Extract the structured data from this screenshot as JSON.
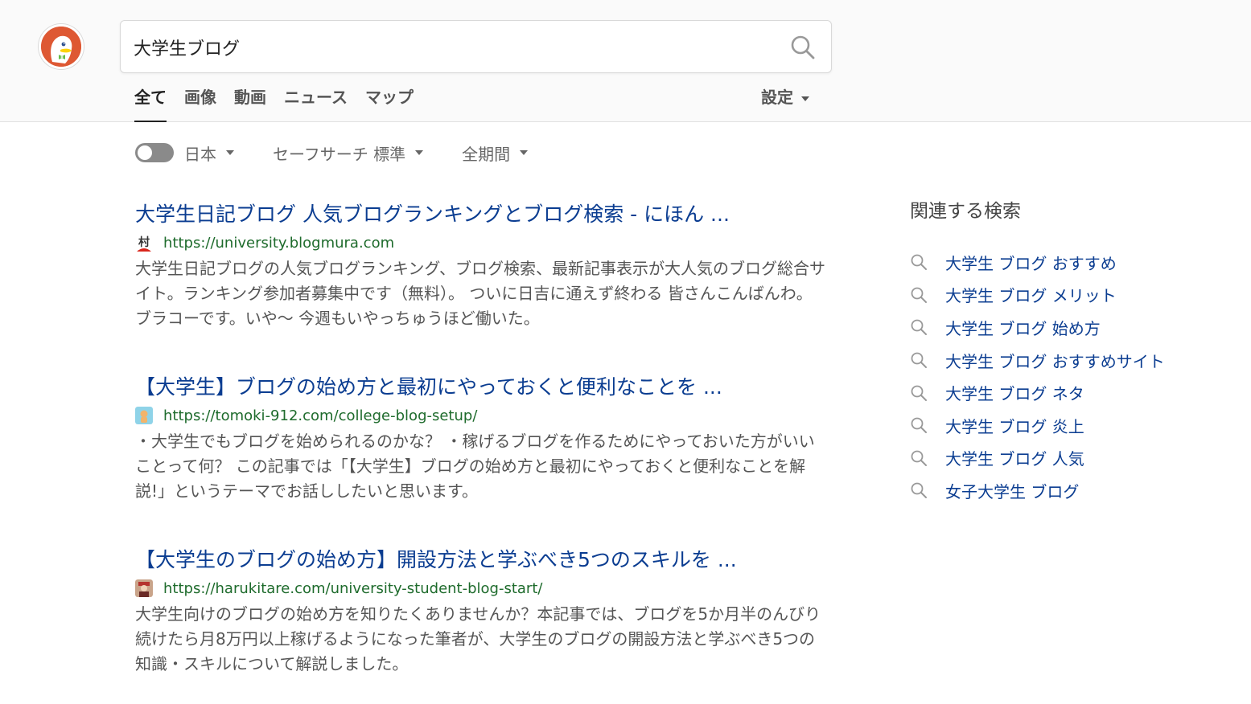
{
  "search": {
    "query": "大学生ブログ",
    "button_icon": "search-icon"
  },
  "tabs": [
    {
      "label": "全て",
      "active": true
    },
    {
      "label": "画像",
      "active": false
    },
    {
      "label": "動画",
      "active": false
    },
    {
      "label": "ニュース",
      "active": false
    },
    {
      "label": "マップ",
      "active": false
    }
  ],
  "settings": {
    "label": "設定"
  },
  "filters": {
    "region_label": "日本",
    "safesearch_label": "セーフサーチ 標準",
    "time_label": "全期間"
  },
  "results": [
    {
      "title": "大学生日記ブログ 人気ブログランキングとブログ検索 - にほん ...",
      "url": "https://university.blogmura.com",
      "favicon": "blogmura-favicon",
      "snippet": "大学生日記ブログの人気ブログランキング、ブログ検索、最新記事表示が大人気のブログ総合サイト。ランキング参加者募集中です（無料）。 ついに日吉に通えず終わる 皆さんこんばんわ。ブラコーです。いや〜 今週もいやっちゅうほど働いた。"
    },
    {
      "title": "【大学生】ブログの始め方と最初にやっておくと便利なことを ...",
      "url": "https://tomoki-912.com/college-blog-setup/",
      "favicon": "tomoki-favicon",
      "snippet": "・大学生でもブログを始められるのかな？ ・稼げるブログを作るためにやっておいた方がいいことって何？ この記事では「【大学生】ブログの始め方と最初にやっておくと便利なことを解説!」というテーマでお話ししたいと思います。"
    },
    {
      "title": "【大学生のブログの始め方】開設方法と学ぶべき5つのスキルを ...",
      "url": "https://harukitare.com/university-student-blog-start/",
      "favicon": "harukitare-favicon",
      "snippet": "大学生向けのブログの始め方を知りたくありませんか？本記事では、ブログを5か月半のんびり続けたら月8万円以上稼げるようになった筆者が、大学生のブログの開設方法と学ぶべき5つの知識・スキルについて解説しました。"
    }
  ],
  "related": {
    "title": "関連する検索",
    "items": [
      "大学生 ブログ おすすめ",
      "大学生 ブログ メリット",
      "大学生 ブログ 始め方",
      "大学生 ブログ おすすめサイト",
      "大学生 ブログ ネタ",
      "大学生 ブログ 炎上",
      "大学生 ブログ 人気",
      "女子大学生 ブログ"
    ]
  },
  "colors": {
    "link": "#0b3d91",
    "url": "#1e6b2c",
    "logo": "#de5833"
  }
}
